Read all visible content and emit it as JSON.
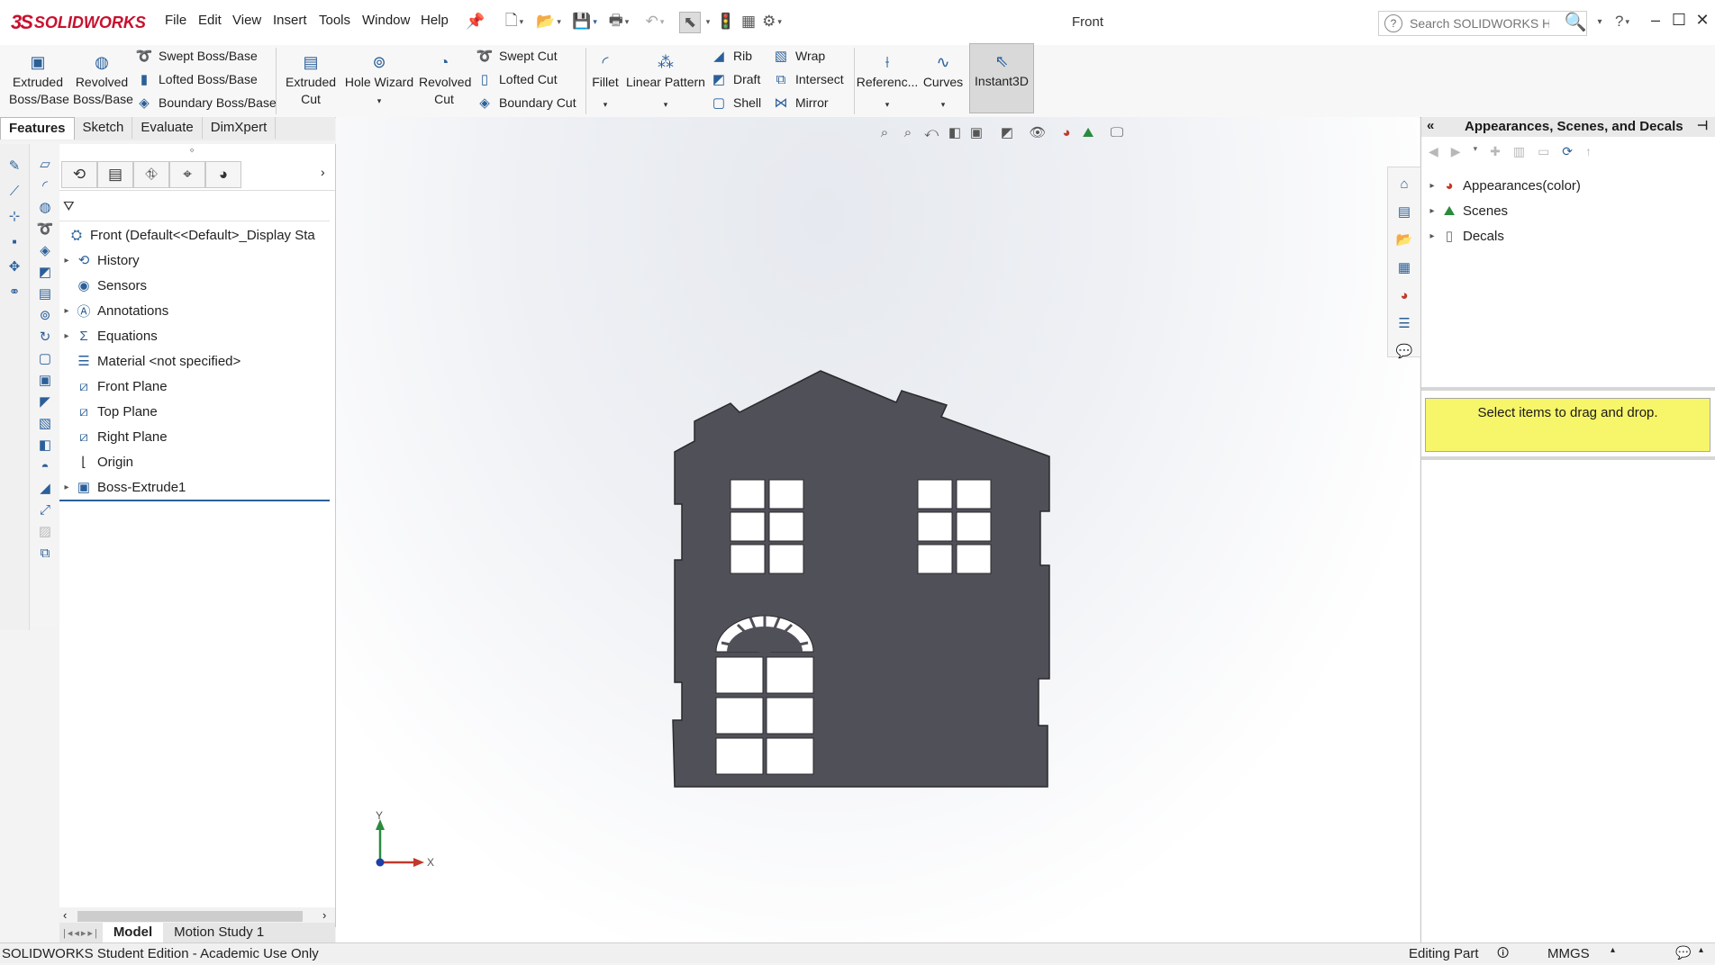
{
  "app": {
    "logo_ds": "3S",
    "logo_text": "SOLIDWORKS",
    "document_title": "Front"
  },
  "menu": [
    "File",
    "Edit",
    "View",
    "Insert",
    "Tools",
    "Window",
    "Help"
  ],
  "search": {
    "placeholder": "Search SOLIDWORKS Help"
  },
  "commands": {
    "extruded_boss": "Extruded Boss/Base",
    "revolved_boss": "Revolved Boss/Base",
    "swept_boss": "Swept Boss/Base",
    "lofted_boss": "Lofted Boss/Base",
    "boundary_boss": "Boundary Boss/Base",
    "extruded_cut": "Extruded Cut",
    "hole_wizard": "Hole Wizard",
    "revolved_cut": "Revolved Cut",
    "swept_cut": "Swept Cut",
    "lofted_cut": "Lofted Cut",
    "boundary_cut": "Boundary Cut",
    "fillet": "Fillet",
    "linear_pattern": "Linear Pattern",
    "rib": "Rib",
    "draft": "Draft",
    "shell": "Shell",
    "wrap": "Wrap",
    "intersect": "Intersect",
    "mirror": "Mirror",
    "reference": "Referenc...",
    "curves": "Curves",
    "instant3d": "Instant3D"
  },
  "command_tabs": [
    "Features",
    "Sketch",
    "Evaluate",
    "DimXpert"
  ],
  "feature_tree": [
    {
      "label": "Front  (Default<<Default>_Display Sta",
      "icon": "part-icon",
      "expandable": false
    },
    {
      "label": "History",
      "icon": "history-icon",
      "expandable": true
    },
    {
      "label": "Sensors",
      "icon": "sensor-icon",
      "expandable": false
    },
    {
      "label": "Annotations",
      "icon": "annotation-icon",
      "expandable": true
    },
    {
      "label": "Equations",
      "icon": "equation-icon",
      "expandable": true
    },
    {
      "label": "Material <not specified>",
      "icon": "material-icon",
      "expandable": false
    },
    {
      "label": "Front Plane",
      "icon": "plane-icon",
      "expandable": false
    },
    {
      "label": "Top Plane",
      "icon": "plane-icon",
      "expandable": false
    },
    {
      "label": "Right Plane",
      "icon": "plane-icon",
      "expandable": false
    },
    {
      "label": "Origin",
      "icon": "origin-icon",
      "expandable": false
    },
    {
      "label": "Boss-Extrude1",
      "icon": "extrude-icon",
      "expandable": true
    }
  ],
  "bottom_tabs": [
    "Model",
    "Motion Study 1"
  ],
  "status": {
    "left": "SOLIDWORKS Student Edition - Academic Use Only",
    "mode": "Editing Part",
    "units": "MMGS"
  },
  "triad": {
    "x": "X",
    "y": "Y"
  },
  "task_pane": {
    "title": "Appearances, Scenes, and Decals",
    "items": [
      "Appearances(color)",
      "Scenes",
      "Decals"
    ],
    "drop_hint": "Select items to drag and drop."
  },
  "colors": {
    "model_fill": "#4f5058",
    "brand_red": "#c8102e",
    "icon_blue": "#2b5f99",
    "drop_yellow": "#f7f56a"
  }
}
